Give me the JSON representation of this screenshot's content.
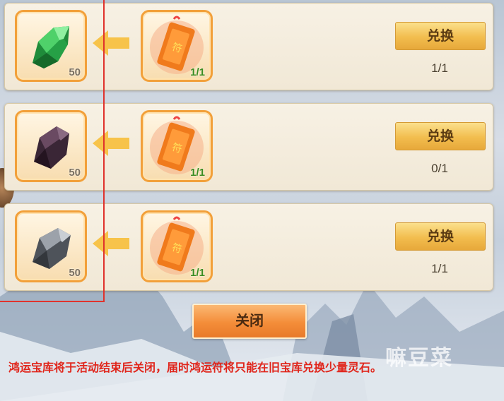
{
  "rows": [
    {
      "material": {
        "icon": "green-crystal-icon",
        "count": "50",
        "color": "#2fae4a"
      },
      "token": {
        "icon": "fortune-charm-icon",
        "count": "1/1"
      },
      "exchange_label": "兑换",
      "progress": "1/1"
    },
    {
      "material": {
        "icon": "dark-purple-ore-icon",
        "count": "50",
        "color": "#4a3346"
      },
      "token": {
        "icon": "fortune-charm-icon",
        "count": "1/1"
      },
      "exchange_label": "兑换",
      "progress": "0/1"
    },
    {
      "material": {
        "icon": "gray-ore-icon",
        "count": "50",
        "color": "#6f747c"
      },
      "token": {
        "icon": "fortune-charm-icon",
        "count": "1/1"
      },
      "exchange_label": "兑换",
      "progress": "1/1"
    }
  ],
  "close_label": "关闭",
  "notice": "鸿运宝库将于活动结束后关闭，届时鸿运符将只能在旧宝库兑换少量灵石。",
  "watermark": "嘛豆菜",
  "colors": {
    "button_gold": "#f2bd4e",
    "close_orange": "#f48d39",
    "item_border": "#f2a03a",
    "notice_red": "#e0261c",
    "highlight_frame": "#e0322c"
  }
}
